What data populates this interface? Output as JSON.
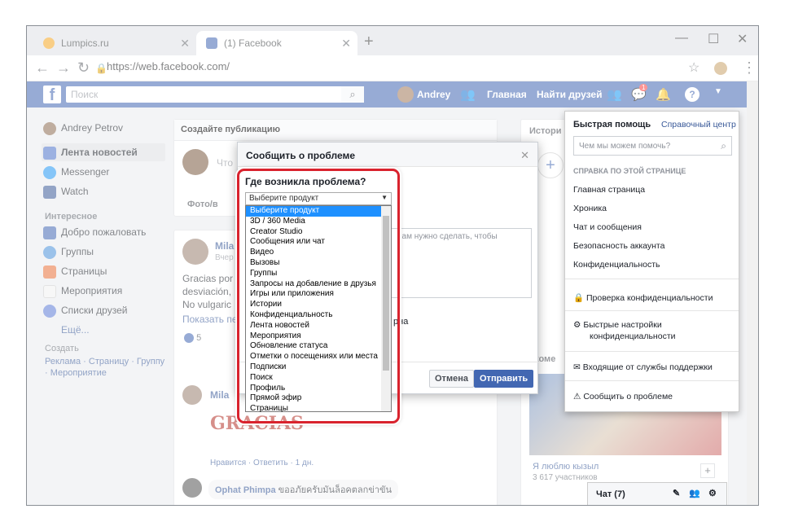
{
  "browser": {
    "tab1": "Lumpics.ru",
    "tab2": "(1) Facebook",
    "url": "https://web.facebook.com/"
  },
  "fb": {
    "search_placeholder": "Поиск",
    "user": "Andrey",
    "home": "Главная",
    "find_friends": "Найти друзей",
    "msg_badge": "1"
  },
  "left_nav": {
    "profile": "Andrey Petrov",
    "items": [
      "Лента новостей",
      "Messenger",
      "Watch"
    ],
    "section_interesting": "Интересное",
    "interesting": [
      "Добро пожаловать",
      "Группы",
      "Страницы",
      "Мероприятия",
      "Списки друзей",
      "Ещё..."
    ],
    "section_create": "Создать",
    "create_links": "Реклама · Страницу · Группу",
    "create_links2": "· Мероприятие"
  },
  "feed": {
    "create_post": "Создайте публикацию",
    "whats_new": "Что",
    "photo": "Фото/в",
    "poster": "Mila",
    "time": "Вчер",
    "post_line1": "Gracias por",
    "post_line2": "desviación,",
    "post_line3": "No vulgaric",
    "show_more": "Показать пе",
    "likes": "5",
    "comment_name": "Mila",
    "comment_actions": "Нравится · Ответить · 1 дн.",
    "comment2_name": "Ophat Phimpa",
    "comment2_text": "ขออภัยครับมันล็อคตลกข่าขัน"
  },
  "dialog": {
    "title": "Сообщить о проблеме",
    "question": "Где возникла проблема?",
    "selected": "Выберите продукт",
    "textarea_hint": "нам нужно сделать, чтобы",
    "side_text": "рна",
    "cancel": "Отмена",
    "send": "Отправить"
  },
  "options": [
    "Выберите продукт",
    "3D / 360 Media",
    "Creator Studio",
    "Сообщения или чат",
    "Видео",
    "Вызовы",
    "Группы",
    "Запросы на добавление в друзья",
    "Игры или приложения",
    "Истории",
    "Конфиденциальность",
    "Лента новостей",
    "Мероприятия",
    "Обновление статуса",
    "Отметки о посещениях или места",
    "Подписки",
    "Поиск",
    "Профиль",
    "Прямой эфир",
    "Страницы"
  ],
  "quick_help": {
    "title": "Быстрая помощь",
    "help_center": "Справочный центр",
    "search_placeholder": "Чем мы можем помочь?",
    "section": "СПРАВКА ПО ЭТОЙ СТРАНИЦЕ",
    "links": [
      "Главная страница",
      "Хроника",
      "Чат и сообщения",
      "Безопасность аккаунта",
      "Конфиденциальность"
    ],
    "privacy_check": "Проверка конфиденциальности",
    "privacy_settings_1": "Быстрые настройки",
    "privacy_settings_2": "конфиденциальности",
    "inbox": "Входящие от службы поддержки",
    "report": "Сообщить о проблеме"
  },
  "right": {
    "stories": "Истори",
    "recommend": "екоме",
    "group_name": "Я люблю кызыл",
    "group_members": "3 617 участников"
  },
  "chat": {
    "label": "Чат (7)"
  }
}
